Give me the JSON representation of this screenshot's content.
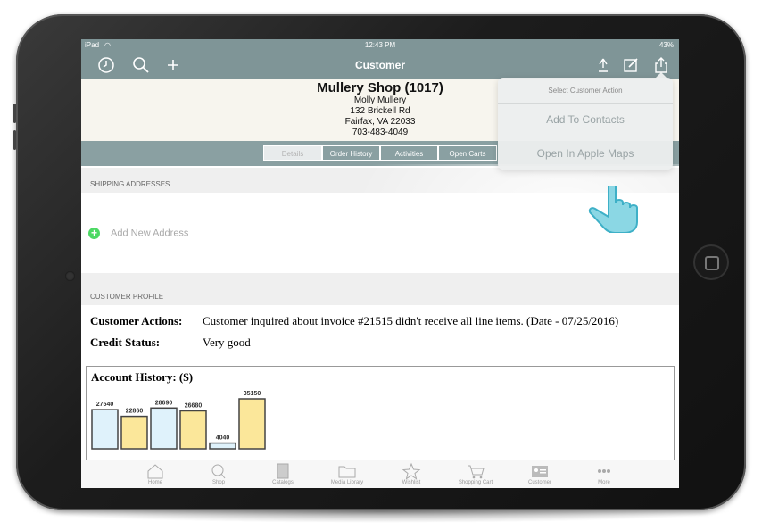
{
  "status_bar": {
    "device": "iPad",
    "time": "12:43 PM",
    "battery": "43%"
  },
  "nav": {
    "title": "Customer",
    "left_icons": [
      "clock-icon",
      "search-icon",
      "plus-icon"
    ],
    "right_icons": [
      "share-up-icon",
      "edit-icon",
      "share-icon"
    ]
  },
  "customer": {
    "name": "Mullery Shop (1017)",
    "contact": "Molly Mullery",
    "address1": "132 Brickell Rd",
    "address2": "Fairfax, VA 22033",
    "phone": "703-483-4049"
  },
  "segments": [
    {
      "label": "Details",
      "active": true
    },
    {
      "label": "Order History",
      "active": false
    },
    {
      "label": "Activities",
      "active": false
    },
    {
      "label": "Open Carts",
      "active": false
    }
  ],
  "shipping": {
    "header": "SHIPPING ADDRESSES",
    "add_label": "Add New Address"
  },
  "profile": {
    "header": "CUSTOMER PROFILE",
    "actions_label": "Customer Actions:",
    "actions_value": "Customer inquired about invoice #21515 didn't receive all line items. (Date - 07/25/2016)",
    "credit_label": "Credit Status:",
    "credit_value": "Very good"
  },
  "chart_data": {
    "type": "bar",
    "title": "Account History: ($)",
    "values": [
      27540,
      22860,
      28690,
      26680,
      4040,
      35150
    ],
    "colors": [
      "#dff2fb",
      "#fbe79a",
      "#dff2fb",
      "#fbe79a",
      "#dff2fb",
      "#fbe79a"
    ],
    "ylim": [
      0,
      35150
    ]
  },
  "popover": {
    "title": "Select Customer Action",
    "items": [
      "Add To Contacts",
      "Open In Apple Maps"
    ]
  },
  "bottom_tabs": [
    {
      "label": "Home",
      "icon": "home-icon"
    },
    {
      "label": "Shop",
      "icon": "search-icon"
    },
    {
      "label": "Catalogs",
      "icon": "catalog-icon"
    },
    {
      "label": "Media Library",
      "icon": "folder-icon"
    },
    {
      "label": "Wishlist",
      "icon": "star-icon"
    },
    {
      "label": "Shopping Cart",
      "icon": "cart-icon"
    },
    {
      "label": "Customer",
      "icon": "contact-card-icon"
    },
    {
      "label": "More",
      "icon": "more-icon"
    }
  ],
  "colors": {
    "nav": "#7f9597",
    "accent_green": "#4cd964",
    "hand": "#5bc4d6"
  }
}
